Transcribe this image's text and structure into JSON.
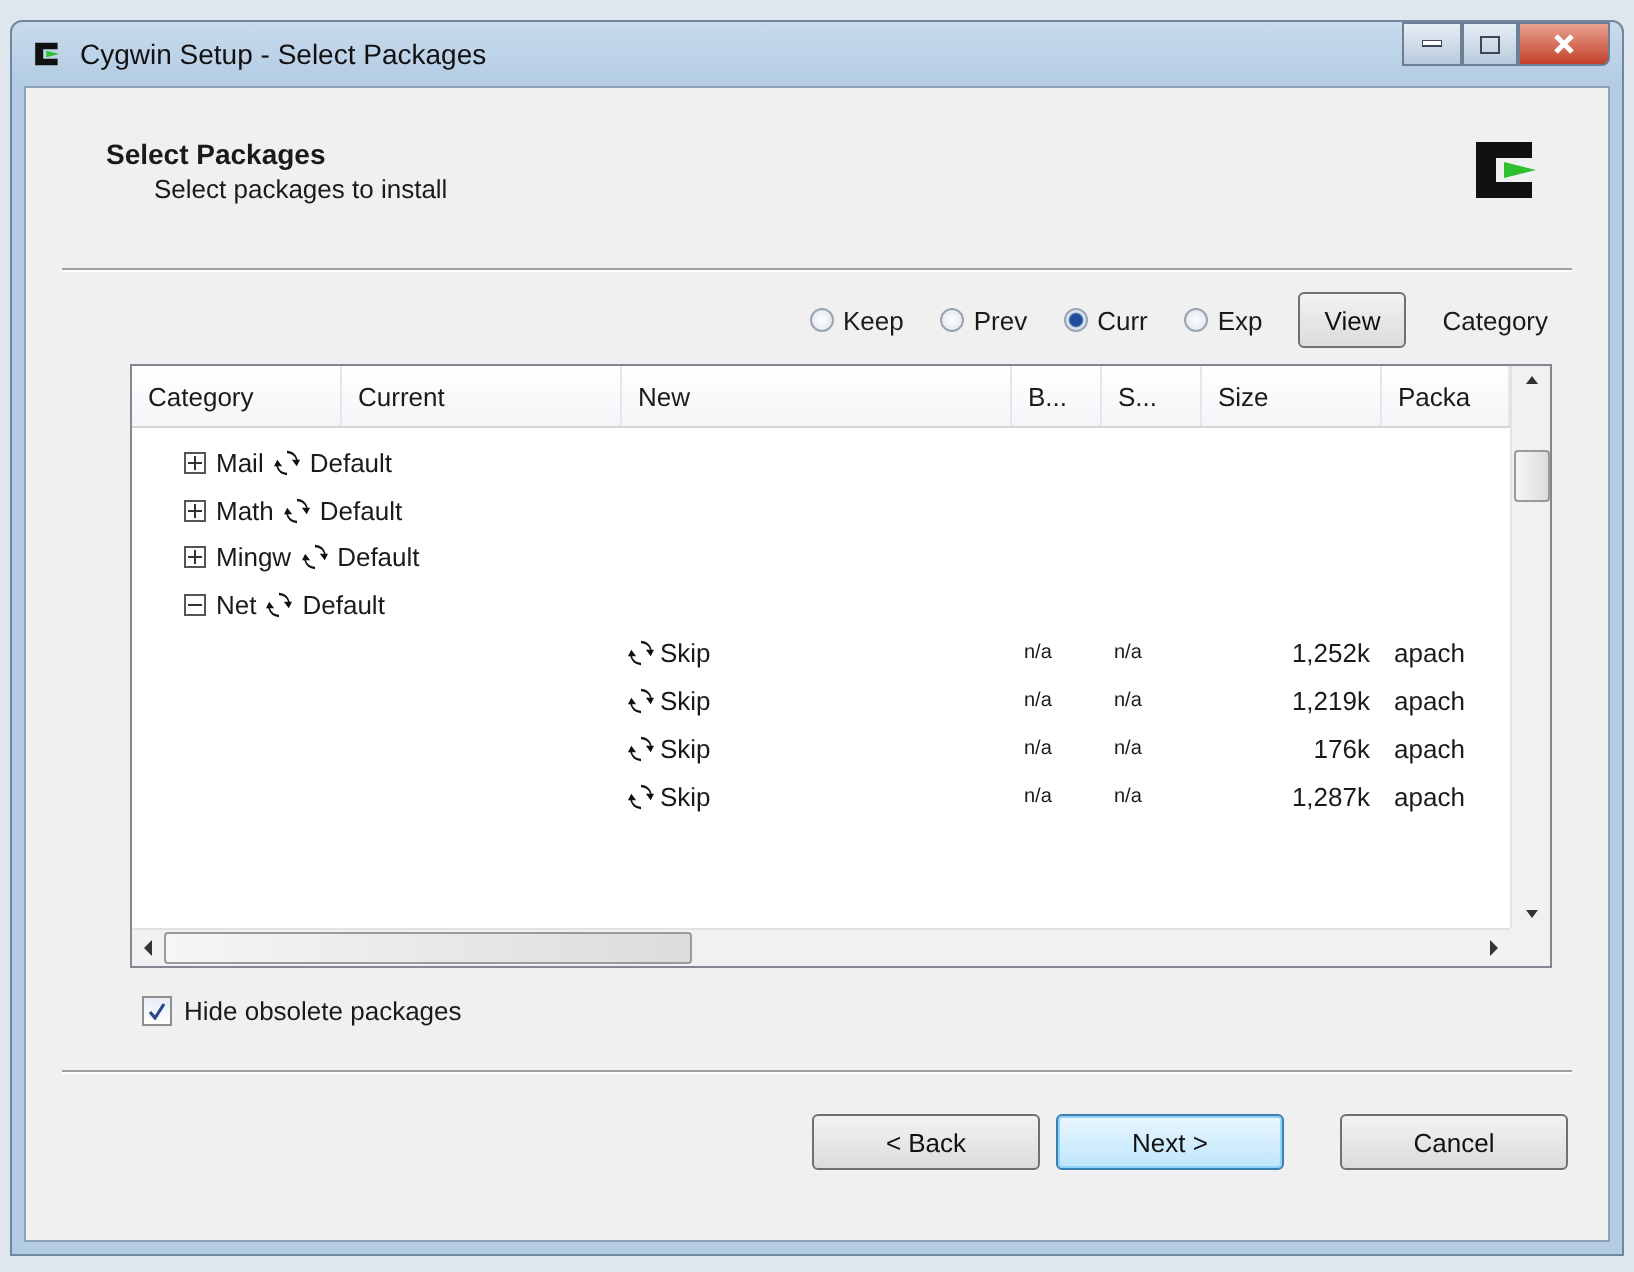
{
  "window": {
    "title": "Cygwin Setup - Select Packages"
  },
  "header": {
    "title": "Select Packages",
    "subtitle": "Select packages to install"
  },
  "view_options": [
    {
      "label": "Keep",
      "selected": false
    },
    {
      "label": "Prev",
      "selected": false
    },
    {
      "label": "Curr",
      "selected": true
    },
    {
      "label": "Exp",
      "selected": false
    }
  ],
  "view_button": "View",
  "view_mode": "Category",
  "table": {
    "columns": [
      "Category",
      "Current",
      "New",
      "B...",
      "S...",
      "Size",
      "Packa"
    ],
    "categories": [
      {
        "name": "Mail",
        "action": "Default",
        "expanded": false
      },
      {
        "name": "Math",
        "action": "Default",
        "expanded": false
      },
      {
        "name": "Mingw",
        "action": "Default",
        "expanded": false
      },
      {
        "name": "Net",
        "action": "Default",
        "expanded": true,
        "children": [
          {
            "new": "Skip",
            "bin": "n/a",
            "src": "n/a",
            "size": "1,252k",
            "package": "apach"
          },
          {
            "new": "Skip",
            "bin": "n/a",
            "src": "n/a",
            "size": "1,219k",
            "package": "apach"
          },
          {
            "new": "Skip",
            "bin": "n/a",
            "src": "n/a",
            "size": "176k",
            "package": "apach"
          },
          {
            "new": "Skip",
            "bin": "n/a",
            "src": "n/a",
            "size": "1,287k",
            "package": "apach"
          }
        ]
      }
    ]
  },
  "hide_obsolete": {
    "label": "Hide obsolete packages",
    "checked": true
  },
  "buttons": [
    {
      "label": "< Back",
      "default": false
    },
    {
      "label": "Next >",
      "default": true
    },
    {
      "label": "Cancel",
      "default": false
    }
  ]
}
